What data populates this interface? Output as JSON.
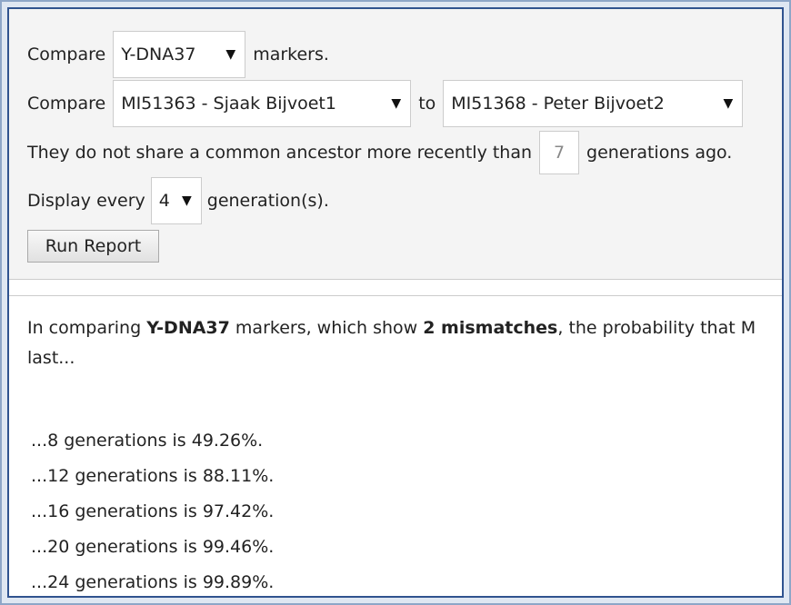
{
  "form": {
    "row1": {
      "prefix": "Compare",
      "marker_select": "Y-DNA37",
      "suffix": "markers."
    },
    "row2": {
      "prefix": "Compare",
      "person1_select": "MI51363 - Sjaak Bijvoet1",
      "joiner": "to",
      "person2_select": "MI51368 - Peter Bijvoet2"
    },
    "row3": {
      "prefix": "They do not share a common ancestor more recently than",
      "generations_value": "7",
      "suffix": "generations ago."
    },
    "row4": {
      "prefix": "Display every",
      "step_select": "4",
      "suffix": "generation(s)."
    },
    "run_button": "Run Report"
  },
  "results": {
    "intro_1": "In comparing ",
    "intro_markers": "Y-DNA37",
    "intro_2": " markers, which show ",
    "intro_mismatches": "2 mismatches",
    "intro_3": ", the probability that M",
    "intro_4": "last...",
    "items": [
      "...8 generations is 49.26%.",
      "...12 generations is 88.11%.",
      "...16 generations is 97.42%.",
      "...20 generations is 99.46%.",
      "...24 generations is 99.89%."
    ]
  }
}
